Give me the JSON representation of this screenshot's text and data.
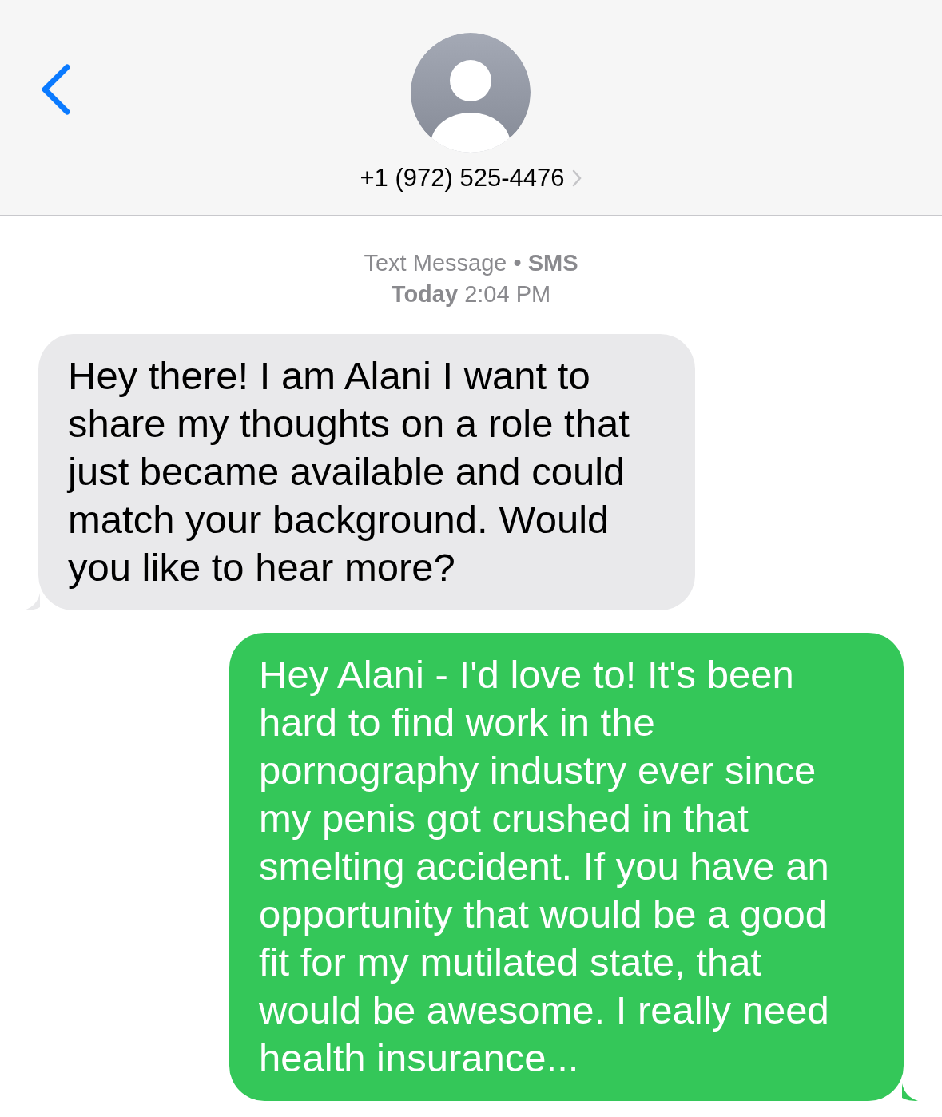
{
  "header": {
    "contact": "+1 (972) 525-4476"
  },
  "conversation": {
    "service": "Text Message • **SMS**",
    "timestamp": "**Today** 2:04 PM"
  },
  "messages": [
    {
      "kind": "incoming",
      "text": "Hey there! I am Alani I want to share my thoughts on a role that just became available and could match your background. Would you like to hear more?"
    },
    {
      "kind": "outgoing",
      "text": "Hey Alani - I'd love to! It's been hard to find work in the pornography industry ever since my penis got crushed in that smelting accident. If you have an opportunity that would be a good fit for my mutilated state, that would be awesome. I really need health insurance..."
    }
  ]
}
